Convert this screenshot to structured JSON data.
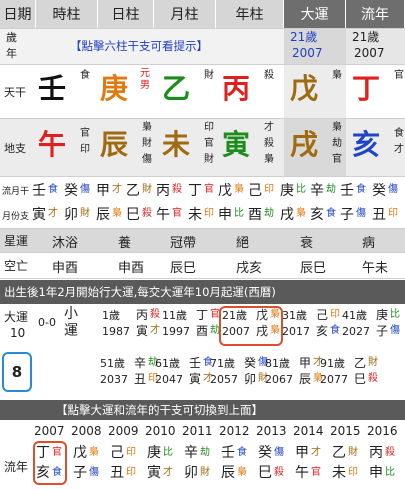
{
  "header": {
    "col0": "日期",
    "col1": "時柱",
    "col2": "日柱",
    "col3": "月柱",
    "col4": "年柱",
    "col5": "大運",
    "col6": "流年"
  },
  "age_row": {
    "label": "歲\n年",
    "hint": "【點擊六柱干支可看提示】",
    "dayun_age": "21歲",
    "dayun_year": "2007",
    "liunian_age": "21歲",
    "liunian_year": "2007"
  },
  "tiangan": {
    "label": "天干",
    "pillars": [
      {
        "char": "壬",
        "god": "食",
        "color": "black"
      },
      {
        "char": "庚",
        "god": "元男",
        "color": "orange"
      },
      {
        "char": "乙",
        "god": "財",
        "color": "green"
      },
      {
        "char": "丙",
        "god": "殺",
        "color": "red"
      },
      {
        "char": "戊",
        "god": "梟",
        "color": "brown"
      },
      {
        "char": "丁",
        "god": "官",
        "color": "red"
      }
    ]
  },
  "dizhi": {
    "label": "地支",
    "pillars": [
      {
        "char": "午",
        "hidden": [
          "官",
          "印"
        ],
        "color": "red"
      },
      {
        "char": "辰",
        "hidden": [
          "梟",
          "財",
          "傷"
        ],
        "color": "brown"
      },
      {
        "char": "未",
        "hidden": [
          "印",
          "官",
          "財"
        ],
        "color": "brown"
      },
      {
        "char": "寅",
        "hidden": [
          "才",
          "殺",
          "梟"
        ],
        "color": "green"
      },
      {
        "char": "戌",
        "hidden": [
          "梟",
          "劫",
          "官"
        ],
        "color": "brown"
      },
      {
        "char": "亥",
        "hidden": [
          "食",
          "才"
        ],
        "color": "blue"
      }
    ]
  },
  "liuyue": {
    "label1": "流月干",
    "label2": "月份支",
    "row1": [
      [
        "壬",
        "食"
      ],
      [
        "癸",
        "傷"
      ],
      [
        "甲",
        "才"
      ],
      [
        "乙",
        "財"
      ],
      [
        "丙",
        "殺"
      ],
      [
        "丁",
        "官"
      ],
      [
        "戊",
        "梟"
      ],
      [
        "己",
        "印"
      ],
      [
        "庚",
        "比"
      ],
      [
        "辛",
        "劫"
      ],
      [
        "壬",
        "食"
      ],
      [
        "癸",
        "傷"
      ]
    ],
    "row2": [
      [
        "寅",
        "才"
      ],
      [
        "卯",
        "財"
      ],
      [
        "辰",
        "梟"
      ],
      [
        "巳",
        "殺"
      ],
      [
        "午",
        "官"
      ],
      [
        "未",
        "印"
      ],
      [
        "申",
        "比"
      ],
      [
        "酉",
        "劫"
      ],
      [
        "戌",
        "梟"
      ],
      [
        "亥",
        "食"
      ],
      [
        "子",
        "傷"
      ],
      [
        "丑",
        "印"
      ]
    ]
  },
  "xingyun": {
    "label": "星運",
    "values": [
      "沐浴",
      "養",
      "冠帶",
      "絕",
      "衰",
      "病"
    ]
  },
  "kongwang": {
    "label": "空亡",
    "values": [
      "申酉",
      "申酉",
      "辰巳",
      "戌亥",
      "辰巳",
      "午未"
    ]
  },
  "dayun_info": "出生後1年2月開始行大運,每交大運年10月起運(西曆)",
  "dayun": {
    "label": "大運",
    "num": "10",
    "start": "0-0",
    "xiaoyun": "小\n運",
    "selected": "8",
    "items": [
      {
        "age": "1歲",
        "year": "1987",
        "g": "丙",
        "z": "寅",
        "gg": "殺",
        "zg": "才"
      },
      {
        "age": "11歲",
        "year": "1997",
        "g": "丁",
        "z": "酉",
        "gg": "官",
        "zg": "劫"
      },
      {
        "age": "21歲",
        "year": "2007",
        "g": "戊",
        "z": "戌",
        "gg": "梟",
        "zg": "梟"
      },
      {
        "age": "31歲",
        "year": "2017",
        "g": "己",
        "z": "亥",
        "gg": "印",
        "zg": "食"
      },
      {
        "age": "41歲",
        "year": "2027",
        "g": "庚",
        "z": "子",
        "gg": "比",
        "zg": "傷"
      },
      {
        "age": "51歲",
        "year": "2037",
        "g": "辛",
        "z": "丑",
        "gg": "劫",
        "zg": "印"
      },
      {
        "age": "61歲",
        "year": "2047",
        "g": "壬",
        "z": "寅",
        "gg": "食",
        "zg": "才"
      },
      {
        "age": "71歲",
        "year": "2057",
        "g": "癸",
        "z": "卯",
        "gg": "傷",
        "zg": "財"
      },
      {
        "age": "81歲",
        "year": "2067",
        "g": "甲",
        "z": "辰",
        "gg": "才",
        "zg": "梟"
      },
      {
        "age": "91歲",
        "year": "2077",
        "g": "乙",
        "z": "巳",
        "gg": "財",
        "zg": "殺"
      }
    ]
  },
  "switch_hint": "【點擊大運和流年的干支可切換到上面】",
  "liunian": {
    "label": "流年",
    "years": [
      "2007",
      "2008",
      "2009",
      "2010",
      "2011",
      "2012",
      "2013",
      "2014",
      "2015",
      "2016"
    ],
    "items": [
      {
        "g": "丁",
        "z": "亥",
        "gg": "官",
        "zg": "食"
      },
      {
        "g": "戊",
        "z": "子",
        "gg": "梟",
        "zg": "傷"
      },
      {
        "g": "己",
        "z": "丑",
        "gg": "印",
        "zg": "印"
      },
      {
        "g": "庚",
        "z": "寅",
        "gg": "比",
        "zg": "才"
      },
      {
        "g": "辛",
        "z": "卯",
        "gg": "劫",
        "zg": "財"
      },
      {
        "g": "壬",
        "z": "辰",
        "gg": "食",
        "zg": "梟"
      },
      {
        "g": "癸",
        "z": "巳",
        "gg": "傷",
        "zg": "殺"
      },
      {
        "g": "甲",
        "z": "午",
        "gg": "才",
        "zg": "官"
      },
      {
        "g": "乙",
        "z": "未",
        "gg": "財",
        "zg": "印"
      },
      {
        "g": "丙",
        "z": "申",
        "gg": "殺",
        "zg": "比"
      }
    ]
  },
  "colors": {
    "black": "#111111",
    "red": "#e02020",
    "green": "#1c8c1c",
    "orange": "#e07a10",
    "blue": "#2046c8",
    "brown": "#a06a10",
    "header_dark": "#6e6e6e",
    "header_light": "#d6d6d6",
    "hint_blue": "#2040c0",
    "select_red": "#d85030",
    "select_blue": "#2a8ad8"
  }
}
